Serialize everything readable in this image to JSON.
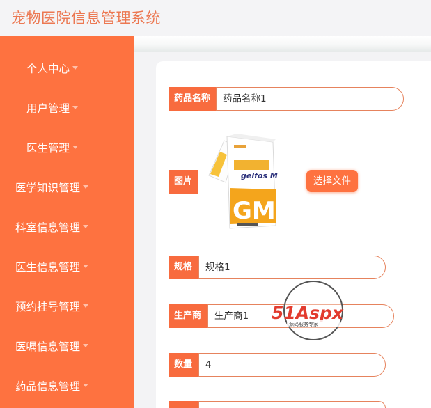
{
  "header": {
    "title": "宠物医院信息管理系统"
  },
  "sidebar": {
    "items": [
      {
        "label": "个人中心"
      },
      {
        "label": "用户管理"
      },
      {
        "label": "医生管理"
      },
      {
        "label": "医学知识管理"
      },
      {
        "label": "科室信息管理"
      },
      {
        "label": "医生信息管理"
      },
      {
        "label": "预约挂号管理"
      },
      {
        "label": "医嘱信息管理"
      },
      {
        "label": "药品信息管理"
      }
    ]
  },
  "form": {
    "name": {
      "label": "药品名称",
      "value": "药品名称1"
    },
    "image": {
      "label": "图片",
      "upload_label": "选择文件",
      "product_text": "gelfos M",
      "product_letters": "GM"
    },
    "spec": {
      "label": "规格",
      "value": "规格1"
    },
    "maker": {
      "label": "生产商",
      "value": "生产商1"
    },
    "qty": {
      "label": "数量",
      "value": "4"
    }
  },
  "watermark": {
    "brand": "51Aspx",
    "tagline": "源码服务专家"
  },
  "colors": {
    "accent": "#fe7240",
    "title": "#ec7852",
    "border": "#e6835d"
  }
}
